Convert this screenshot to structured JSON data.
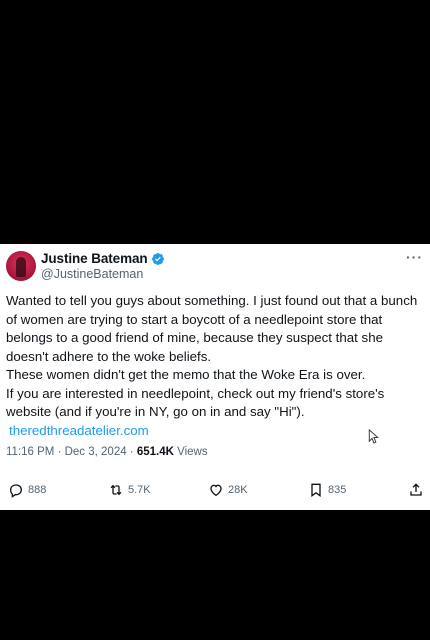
{
  "tweet": {
    "display_name": "Justine Bateman",
    "handle": "@JustineBateman",
    "more_label": "···",
    "paragraphs": [
      "Wanted to tell you guys about something. I just found out that a bunch of women are trying to start a boycott of a needlepoint store that belongs to a good friend of mine, because they suspect that she doesn't adhere to the woke beliefs.",
      "These women didn't get the memo that the Woke Era is over.",
      "If you are interested in needlepoint, check out my friend's store's website (and if you're in NY, go on in and say \"Hi\")."
    ],
    "link": "theredthreadatelier.com",
    "timestamp": "11:16 PM · Dec 3, 2024 · ",
    "views_count": "651.4K",
    "views_label": " Views"
  },
  "actions": {
    "replies": "888",
    "reposts": "5.7K",
    "likes": "28K",
    "bookmarks": "835"
  },
  "colors": {
    "link": "#1d9bf0",
    "verified": "#1d9bf0",
    "secondary_text": "#536471",
    "avatar": "#c2204a"
  },
  "icons": [
    "verified-badge-icon",
    "more-icon",
    "reply-icon",
    "repost-icon",
    "like-icon",
    "bookmark-icon",
    "share-icon",
    "mouse-cursor-icon"
  ]
}
